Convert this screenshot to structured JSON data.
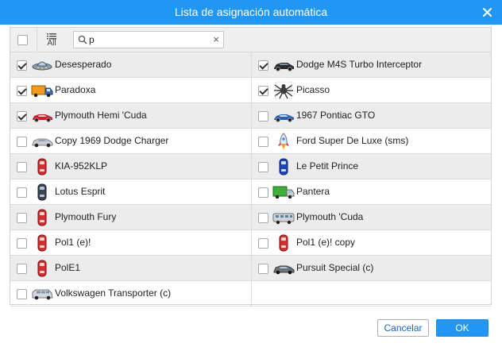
{
  "dialog": {
    "title": "Lista de asignación automática",
    "close_icon": "close-icon"
  },
  "toolbar": {
    "select_all_checked": false,
    "filter_label": "All",
    "search_value": "p",
    "search_icon": "search-icon",
    "clear_icon": "clear-icon",
    "clear_glyph": "×"
  },
  "units": [
    {
      "name": "Desesperado",
      "checked": true,
      "icon": "ufo-icon"
    },
    {
      "name": "Dodge M4S Turbo Interceptor",
      "checked": true,
      "icon": "black-sports-car-icon"
    },
    {
      "name": "Paradoxa",
      "checked": true,
      "icon": "orange-truck-icon"
    },
    {
      "name": "Picasso",
      "checked": true,
      "icon": "spider-icon"
    },
    {
      "name": "Plymouth Hemi 'Cuda",
      "checked": true,
      "icon": "red-car-icon"
    },
    {
      "name": "1967 Pontiac GTO",
      "checked": false,
      "icon": "blue-car-icon"
    },
    {
      "name": "Copy 1969 Dodge Charger",
      "checked": false,
      "icon": "silver-car-icon"
    },
    {
      "name": "Ford Super De Luxe (sms)",
      "checked": false,
      "icon": "rocket-icon"
    },
    {
      "name": "KIA-952KLP",
      "checked": false,
      "icon": "red-car-top-icon"
    },
    {
      "name": "Le Petit Prince",
      "checked": false,
      "icon": "blue-car-top-icon"
    },
    {
      "name": "Lotus Esprit",
      "checked": false,
      "icon": "dark-car-top-icon"
    },
    {
      "name": "Pantera",
      "checked": false,
      "icon": "green-truck-icon"
    },
    {
      "name": "Plymouth Fury",
      "checked": false,
      "icon": "red-car-top-icon"
    },
    {
      "name": "Plymouth 'Cuda",
      "checked": false,
      "icon": "bus-icon"
    },
    {
      "name": "Pol1 (e)!",
      "checked": false,
      "icon": "red-car-top-icon"
    },
    {
      "name": "Pol1 (e)! copy",
      "checked": false,
      "icon": "red-car-top-icon"
    },
    {
      "name": "PolE1",
      "checked": false,
      "icon": "red-car-top-icon"
    },
    {
      "name": "Pursuit Special (c)",
      "checked": false,
      "icon": "gray-car-icon"
    },
    {
      "name": "Volkswagen Transporter (c)",
      "checked": false,
      "icon": "van-icon"
    }
  ],
  "footer": {
    "cancel_label": "Cancelar",
    "ok_label": "OK"
  },
  "colors": {
    "header": "#2196f3",
    "row_alt": "#ececec",
    "cancel_text": "#1565c0"
  }
}
